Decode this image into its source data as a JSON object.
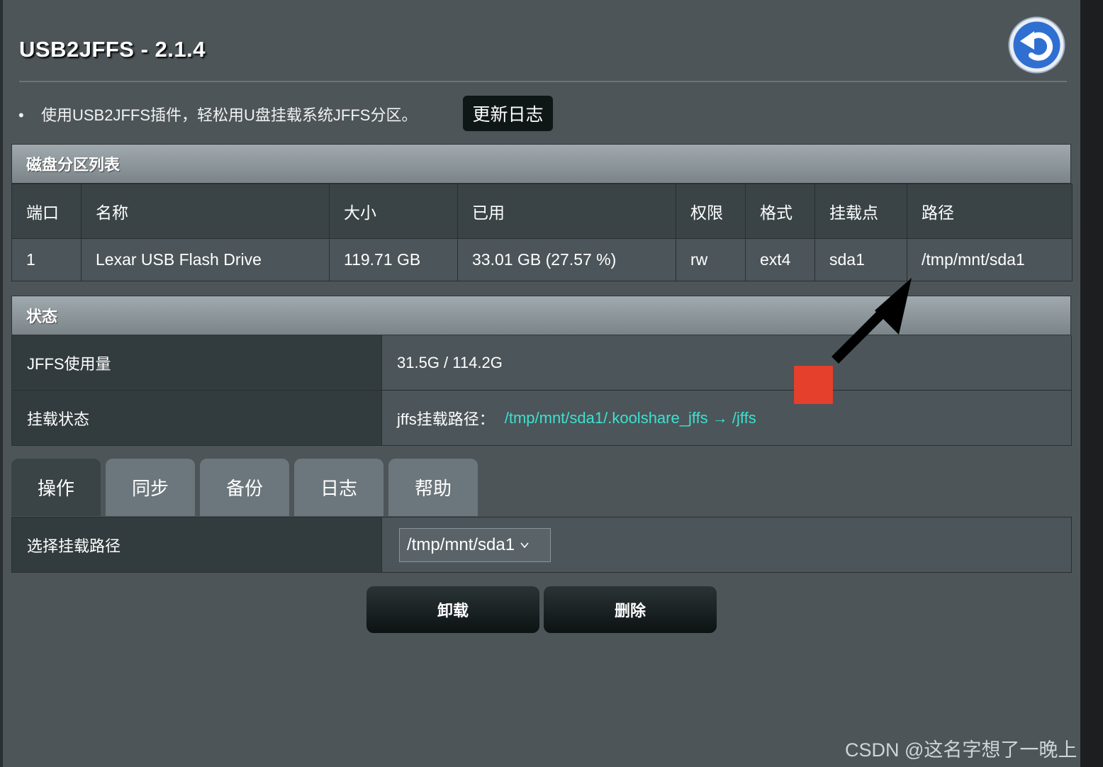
{
  "header": {
    "title": "USB2JFFS - 2.1.4",
    "back_icon": "back-arrow-icon"
  },
  "intro": {
    "bullet": "•",
    "text": "使用USB2JFFS插件，轻松用U盘挂载系统JFFS分区。",
    "changelog_label": "更新日志"
  },
  "disk_section": {
    "title": "磁盘分区列表",
    "columns": [
      "端口",
      "名称",
      "大小",
      "已用",
      "权限",
      "格式",
      "挂载点",
      "路径"
    ],
    "rows": [
      [
        "1",
        "Lexar USB Flash Drive",
        "119.71 GB",
        "33.01 GB (27.57 %)",
        "rw",
        "ext4",
        "sda1",
        "/tmp/mnt/sda1"
      ]
    ]
  },
  "status_section": {
    "title": "状态",
    "jffs_usage_label": "JFFS使用量",
    "jffs_usage_value": "31.5G / 114.2G",
    "mount_status_label": "挂载状态",
    "mount_path_prefix": "jffs挂载路径：",
    "mount_path_link": "/tmp/mnt/sda1/.koolshare_jffs → /jffs"
  },
  "tabs": [
    {
      "label": "操作",
      "active": true
    },
    {
      "label": "同步",
      "active": false
    },
    {
      "label": "备份",
      "active": false
    },
    {
      "label": "日志",
      "active": false
    },
    {
      "label": "帮助",
      "active": false
    }
  ],
  "operation": {
    "select_label": "选择挂载路径",
    "select_value": "/tmp/mnt/sda1"
  },
  "buttons": {
    "unmount": "卸载",
    "delete": "删除"
  },
  "watermark": "CSDN @这名字想了一晚上",
  "colors": {
    "background": "#4d5559",
    "link": "#3ee0d0",
    "annotation_red": "#e4402b",
    "back_button_blue": "#2f6fd1"
  }
}
